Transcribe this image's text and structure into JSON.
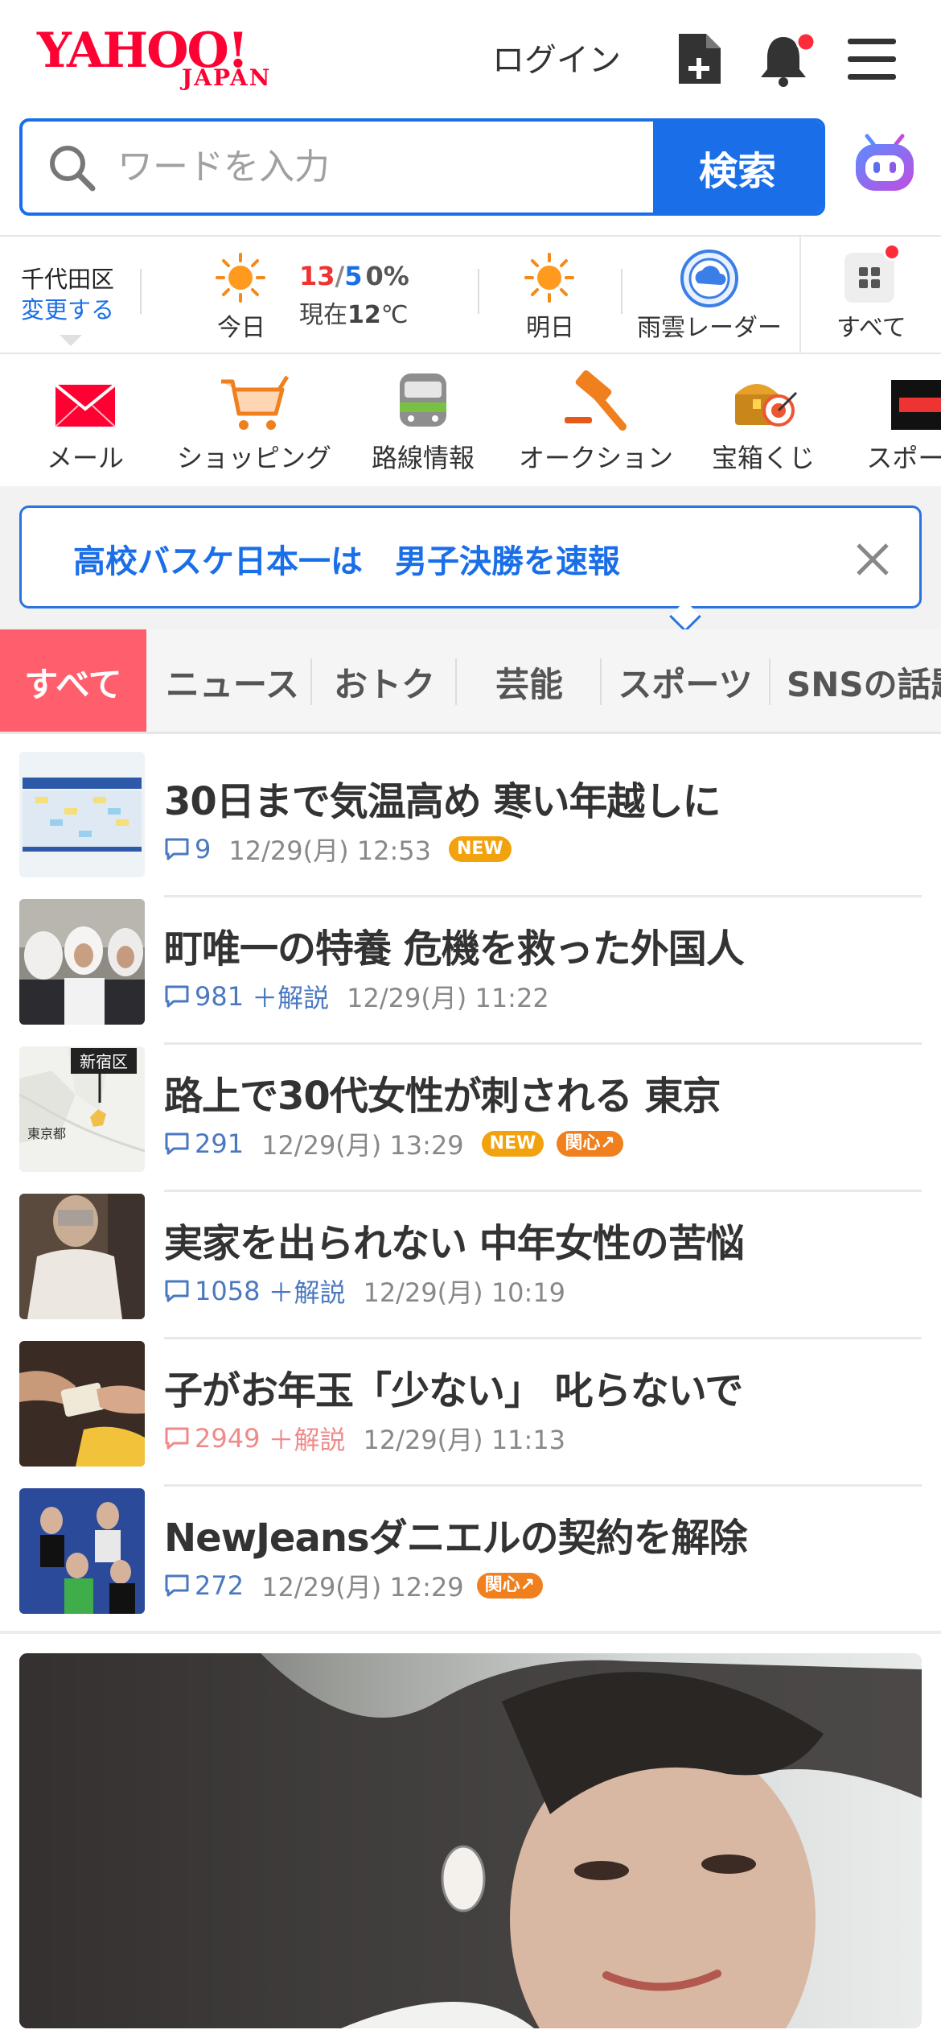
{
  "header": {
    "logo_main": "YAHOO!",
    "logo_sub": "JAPAN",
    "login": "ログイン"
  },
  "search": {
    "placeholder": "ワードを入力",
    "button": "検索"
  },
  "weather": {
    "location": "千代田区",
    "change": "変更する",
    "today_label": "今日",
    "high": "13",
    "sep": "/",
    "low": "5",
    "precip": "0%",
    "now_prefix": "現在",
    "now_temp": "12",
    "now_unit": "℃",
    "tomorrow_label": "明日",
    "radar_label": "雨雲レーダー",
    "all_label": "すべて"
  },
  "services": [
    {
      "label": "メール",
      "icon": "mail-icon"
    },
    {
      "label": "ショッピング",
      "icon": "shopping-cart-icon"
    },
    {
      "label": "路線情報",
      "icon": "train-icon"
    },
    {
      "label": "オークション",
      "icon": "auction-hammer-icon"
    },
    {
      "label": "宝箱くじ",
      "icon": "treasure-box-icon"
    },
    {
      "label": "スポーツ",
      "icon": "sports-icon"
    }
  ],
  "banner": {
    "text": "高校バスケ日本一は　男子決勝を速報"
  },
  "tabs": [
    "すべて",
    "ニュース",
    "おトク",
    "芸能",
    "スポーツ",
    "SNSの話題"
  ],
  "news": [
    {
      "title": "30日まで気温高め 寒い年越しに",
      "comments": "9",
      "kaisetsu": "",
      "time": "12/29(月) 12:53",
      "new": "NEW",
      "interest": ""
    },
    {
      "title": "町唯一の特養 危機を救った外国人",
      "comments": "981",
      "kaisetsu": "＋解説",
      "time": "12/29(月) 11:22",
      "new": "",
      "interest": ""
    },
    {
      "title": "路上で30代女性が刺される 東京",
      "comments": "291",
      "kaisetsu": "",
      "time": "12/29(月) 13:29",
      "new": "NEW",
      "interest": "関心↗"
    },
    {
      "title": "実家を出られない 中年女性の苦悩",
      "comments": "1058",
      "kaisetsu": "＋解説",
      "time": "12/29(月) 10:19",
      "new": "",
      "interest": ""
    },
    {
      "title": "子がお年玉「少ない」 叱らないで",
      "comments": "2949",
      "kaisetsu": "＋解説",
      "time": "12/29(月) 11:13",
      "new": "",
      "interest": ""
    },
    {
      "title": "NewJeansダニエルの契約を解除",
      "comments": "272",
      "kaisetsu": "",
      "time": "12/29(月) 12:29",
      "new": "",
      "interest": "関心↗"
    }
  ],
  "map_labels": {
    "ward": "新宿区",
    "city": "東京都"
  }
}
